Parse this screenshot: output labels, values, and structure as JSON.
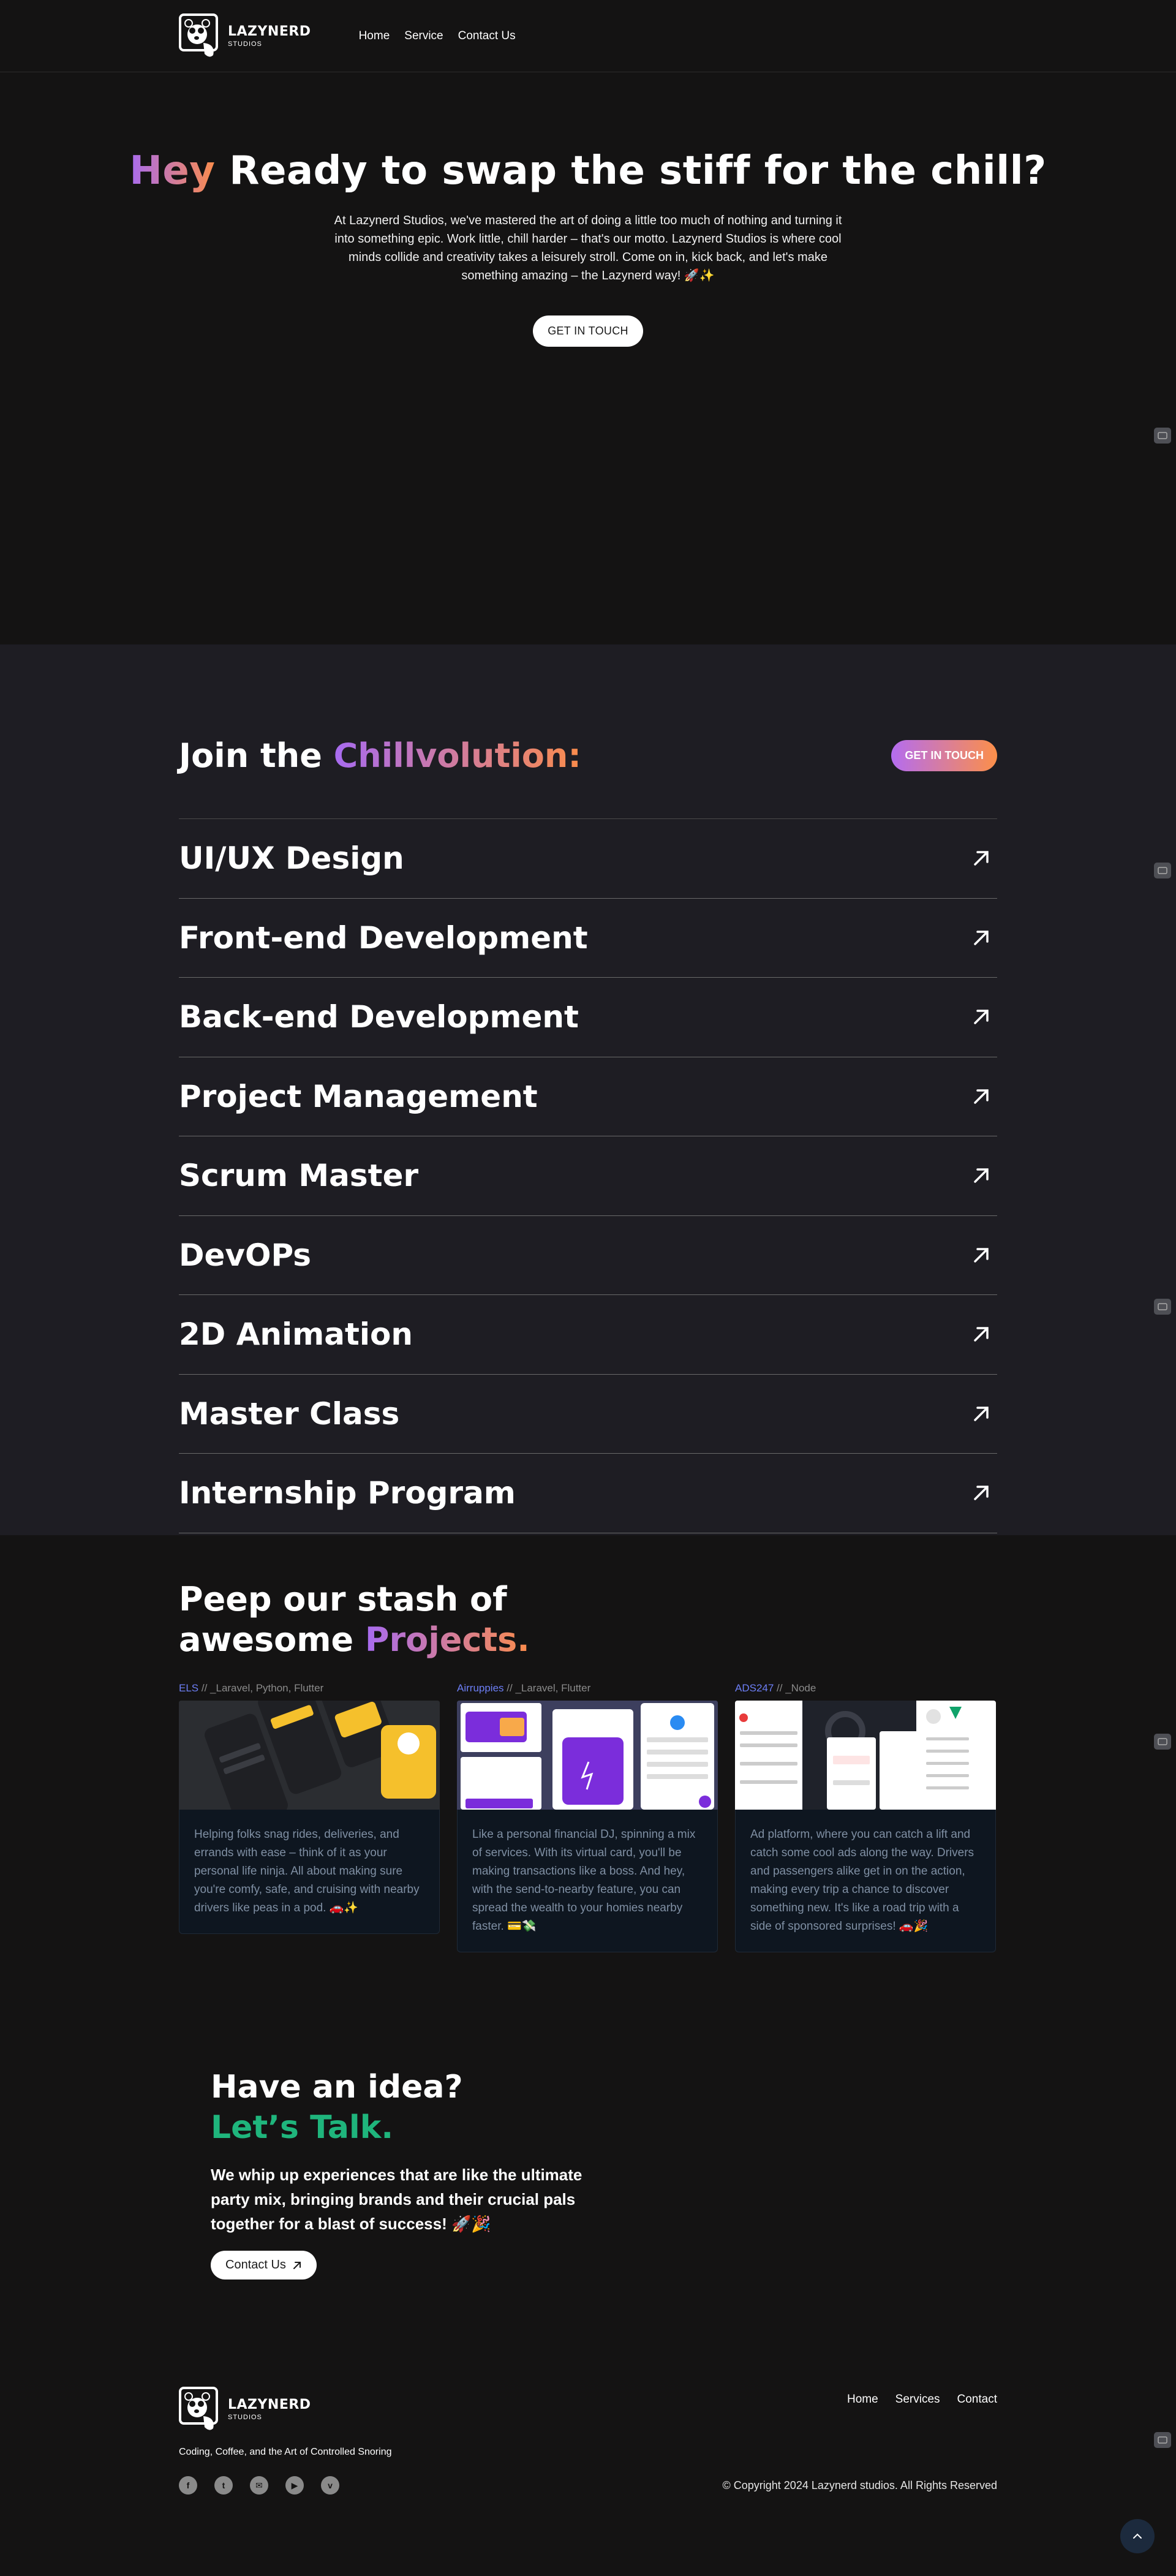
{
  "nav": {
    "logo_line1": "LAZYNERD",
    "logo_line2": "STUDIOS",
    "links": [
      "Home",
      "Service",
      "Contact Us"
    ]
  },
  "hero": {
    "title_accent": "Hey",
    "title_rest": " Ready to swap the stiff for the chill?",
    "body": "At Lazynerd Studios, we've mastered the art of doing a little too much of nothing and turning it into something epic. Work little, chill harder – that's our motto. Lazynerd Studios is where cool minds collide and creativity takes a leisurely stroll. Come on in, kick back, and let's make something amazing – the Lazynerd way! 🚀✨",
    "cta": "GET IN TOUCH"
  },
  "services": {
    "title_prefix": "Join the ",
    "title_accent": "Chillvolution:",
    "cta": "GET IN TOUCH",
    "items": [
      "UI/UX Design",
      "Front-end Development",
      "Back-end Development",
      "Project Management",
      "Scrum Master",
      "DevOPs",
      "2D Animation",
      "Master Class",
      "Internship Program"
    ]
  },
  "projects": {
    "title_line1": "Peep our stash of",
    "title_line2_prefix": "awesome ",
    "title_accent": "Projects.",
    "items": [
      {
        "name": "ELS",
        "stack": " // _Laravel, Python, Flutter",
        "desc": "Helping folks snag rides, deliveries, and errands with ease – think of it as your personal life ninja. All about making sure you're comfy, safe, and cruising with nearby drivers like peas in a pod. 🚗✨"
      },
      {
        "name": "Airruppies",
        "stack": " // _Laravel, Flutter",
        "desc": "Like a personal financial DJ, spinning a mix of services. With its virtual card, you'll be making transactions like a boss. And hey, with the send-to-nearby feature, you can spread the wealth to your homies nearby faster. 💳💸"
      },
      {
        "name": "ADS247",
        "stack": " // _Node",
        "desc": "Ad platform, where you can catch a lift and catch some cool ads along the way. Drivers and passengers alike get in on the action, making every trip a chance to discover something new. It's like a road trip with a side of sponsored surprises! 🚗🎉"
      }
    ]
  },
  "idea": {
    "line1": "Have an idea?",
    "line2": "Let’s Talk.",
    "body": "We whip up experiences that are like the ultimate party mix, bringing brands and their crucial pals together for a blast of success! 🚀🎉",
    "cta": "Contact Us"
  },
  "footer": {
    "logo_line1": "LAZYNERD",
    "logo_line2": "STUDIOS",
    "links": [
      "Home",
      "Services",
      "Contact"
    ],
    "tagline": "Coding, Coffee, and the Art of Controlled Snoring",
    "socials": [
      "facebook-icon",
      "twitter-icon",
      "email-icon",
      "youtube-icon",
      "vimeo-icon"
    ],
    "copyright": "© Copyright 2024 Lazynerd studios. All Rights Reserved"
  },
  "colors": {
    "background": "#141313",
    "services_bg": "#1e1d23",
    "gradient_start": "#a76bf0",
    "gradient_end": "#fb8c4b",
    "green": "#1fb57c",
    "project_link": "#6d7ff6"
  }
}
